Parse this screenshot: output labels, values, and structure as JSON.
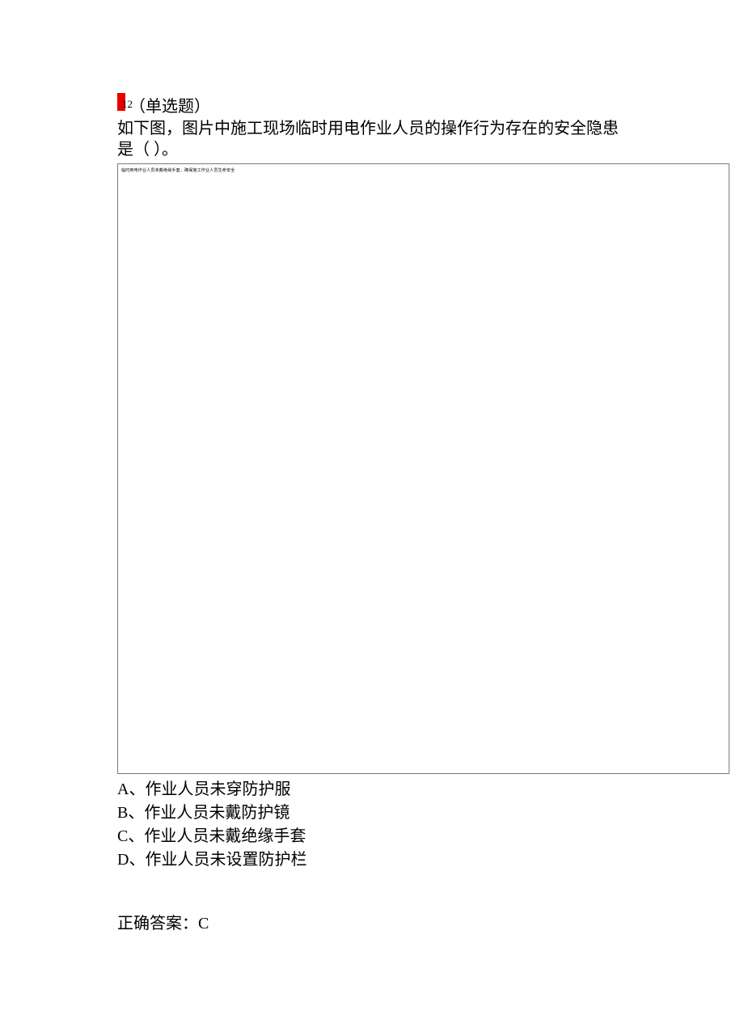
{
  "question": {
    "number": "12",
    "type": "（单选题）",
    "text": "如下图，图片中施工现场临时用电作业人员的操作行为存在的安全隐患是（ ）。",
    "image_badge": "临时用电作业人员未戴绝缘手套，确保施工作业人员生命安全",
    "options": [
      {
        "label": "A、作业人员未穿防护服"
      },
      {
        "label": "B、作业人员未戴防护镜"
      },
      {
        "label": "C、作业人员未戴绝缘手套"
      },
      {
        "label": "D、作业人员未设置防护栏"
      }
    ],
    "answer_label": "正确答案：C"
  }
}
